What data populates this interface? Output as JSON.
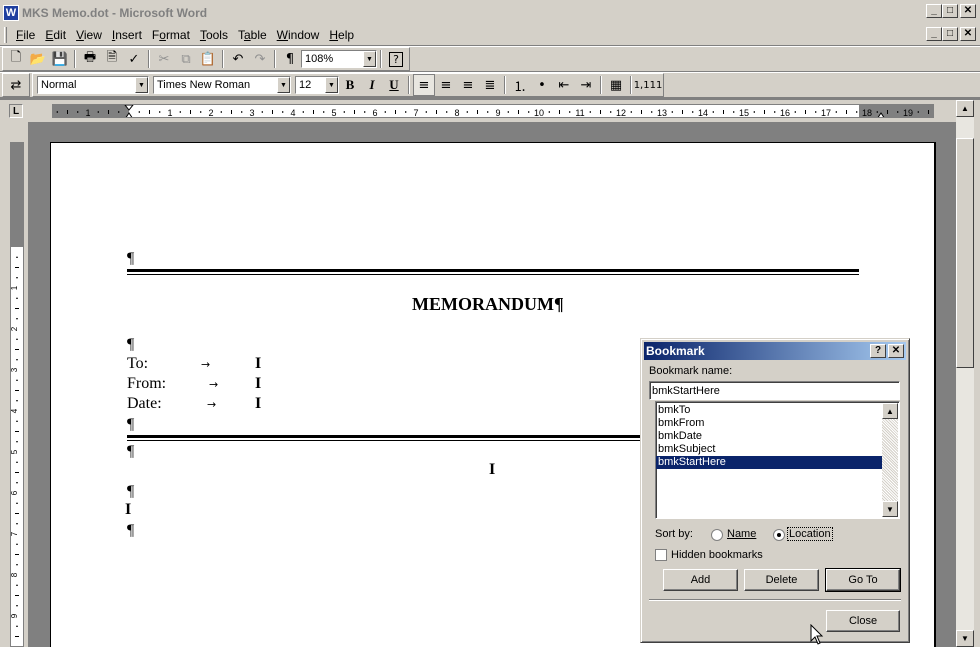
{
  "window": {
    "title": "MKS Memo.dot - Microsoft Word",
    "app_icon": "W",
    "minimize": "_",
    "restore": "□",
    "close": "✕"
  },
  "menu": [
    "File",
    "Edit",
    "View",
    "Insert",
    "Format",
    "Tools",
    "Table",
    "Window",
    "Help"
  ],
  "menu_access": [
    "F",
    "E",
    "V",
    "I",
    "o",
    "T",
    "a",
    "W",
    "H"
  ],
  "toolbar": {
    "zoom": "108%",
    "show_marks": "¶",
    "help": "?"
  },
  "formatting": {
    "style": "Normal",
    "font": "Times New Roman",
    "size": "12",
    "bold": "B",
    "italic": "I",
    "underline": "U",
    "columns_label": "1,111"
  },
  "ruler": {
    "numbers": [
      "1",
      "1",
      "2",
      "3",
      "4",
      "5",
      "6",
      "7",
      "8",
      "9",
      "10",
      "11",
      "12",
      "13",
      "14",
      "15",
      "16",
      "17",
      "18",
      "19"
    ],
    "tab_selector": "L"
  },
  "document": {
    "title": "MEMORANDUM¶",
    "pilcrow": "¶",
    "fields": [
      {
        "label": "To:"
      },
      {
        "label": "From:"
      },
      {
        "label": "Date:"
      }
    ],
    "tab_arrow": "→",
    "bookmark_marker": "I"
  },
  "dialog": {
    "title": "Bookmark",
    "help": "?",
    "close_x": "✕",
    "name_label": "Bookmark name:",
    "name_value": "bmkStartHere",
    "bookmarks": [
      "bmkTo",
      "bmkFrom",
      "bmkDate",
      "bmkSubject",
      "bmkStartHere"
    ],
    "selected_index": 4,
    "sort_by_label": "Sort by:",
    "sort_name": "Name",
    "sort_location": "Location",
    "sort_selected": "Location",
    "hidden_label": "Hidden bookmarks",
    "hidden_checked": false,
    "add": "Add",
    "delete": "Delete",
    "goto": "Go To",
    "close": "Close"
  }
}
